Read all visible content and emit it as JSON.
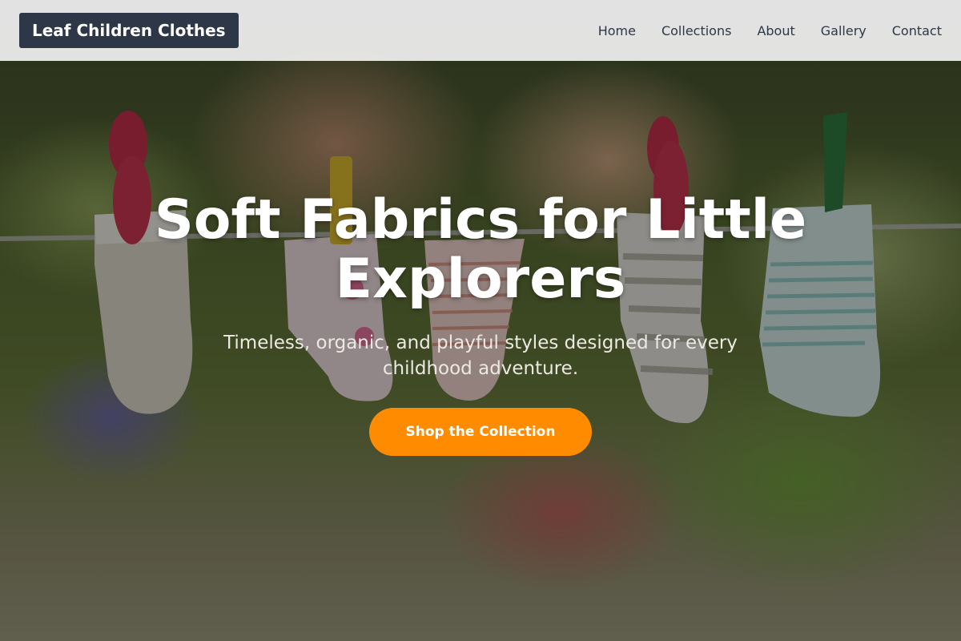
{
  "header": {
    "brand": "Leaf Children Clothes",
    "nav": [
      {
        "label": "Home"
      },
      {
        "label": "Collections"
      },
      {
        "label": "About"
      },
      {
        "label": "Gallery"
      },
      {
        "label": "Contact"
      }
    ]
  },
  "hero": {
    "title": "Soft Fabrics for Little Explorers",
    "subtitle": "Timeless, organic, and playful styles designed for every childhood adventure.",
    "cta_label": "Shop the Collection",
    "background_image": "baby socks hanging on a clothesline with clothespins in a garden"
  },
  "colors": {
    "brand_bg": "#2d3748",
    "cta_bg": "#ff8c00",
    "header_bg": "#f0f0f0"
  }
}
